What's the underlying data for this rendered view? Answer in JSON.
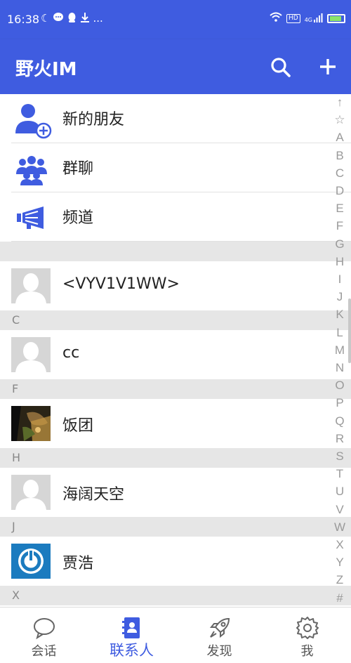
{
  "status_bar": {
    "time": "16:38",
    "left_icons": [
      "moon-icon",
      "chat-bubble-icon",
      "qq-icon",
      "download-icon",
      "more-icon"
    ],
    "right_icons": [
      "wifi-icon",
      "hd-icon",
      "signal-4g-icon",
      "battery-icon"
    ],
    "more": "...",
    "hd": "HD",
    "signal": "4G"
  },
  "app_bar": {
    "title": "野火IM",
    "actions": [
      "search-icon",
      "add-icon"
    ]
  },
  "quick_entries": [
    {
      "label": "新的朋友",
      "icon": "add-friend-icon"
    },
    {
      "label": "群聊",
      "icon": "group-icon"
    },
    {
      "label": "频道",
      "icon": "megaphone-icon"
    }
  ],
  "contacts": [
    {
      "section": "",
      "name": "<VYV1V1WW>",
      "avatar": "default-avatar"
    },
    {
      "section": "C",
      "name": "cc",
      "avatar": "default-avatar"
    },
    {
      "section": "F",
      "name": "饭团",
      "avatar": "photo-avatar"
    },
    {
      "section": "H",
      "name": "海阔天空",
      "avatar": "default-avatar"
    },
    {
      "section": "J",
      "name": "贾浩",
      "avatar": "power-logo-avatar"
    },
    {
      "section": "X",
      "name": "",
      "avatar": ""
    }
  ],
  "index_letters": [
    "↑",
    "☆",
    "A",
    "B",
    "C",
    "D",
    "E",
    "F",
    "G",
    "H",
    "I",
    "J",
    "K",
    "L",
    "M",
    "N",
    "O",
    "P",
    "Q",
    "R",
    "S",
    "T",
    "U",
    "V",
    "W",
    "X",
    "Y",
    "Z",
    "#"
  ],
  "bottom_nav": {
    "items": [
      {
        "label": "会话",
        "icon": "chat-bubble-icon",
        "active": false
      },
      {
        "label": "联系人",
        "icon": "contacts-book-icon",
        "active": true
      },
      {
        "label": "发现",
        "icon": "rocket-icon",
        "active": false
      },
      {
        "label": "我",
        "icon": "gear-icon",
        "active": false
      }
    ]
  },
  "colors": {
    "primary": "#3f5ce0",
    "section_bg": "#e6e6e6",
    "index_text": "#9a9a9a",
    "inactive_nav": "#555555"
  }
}
